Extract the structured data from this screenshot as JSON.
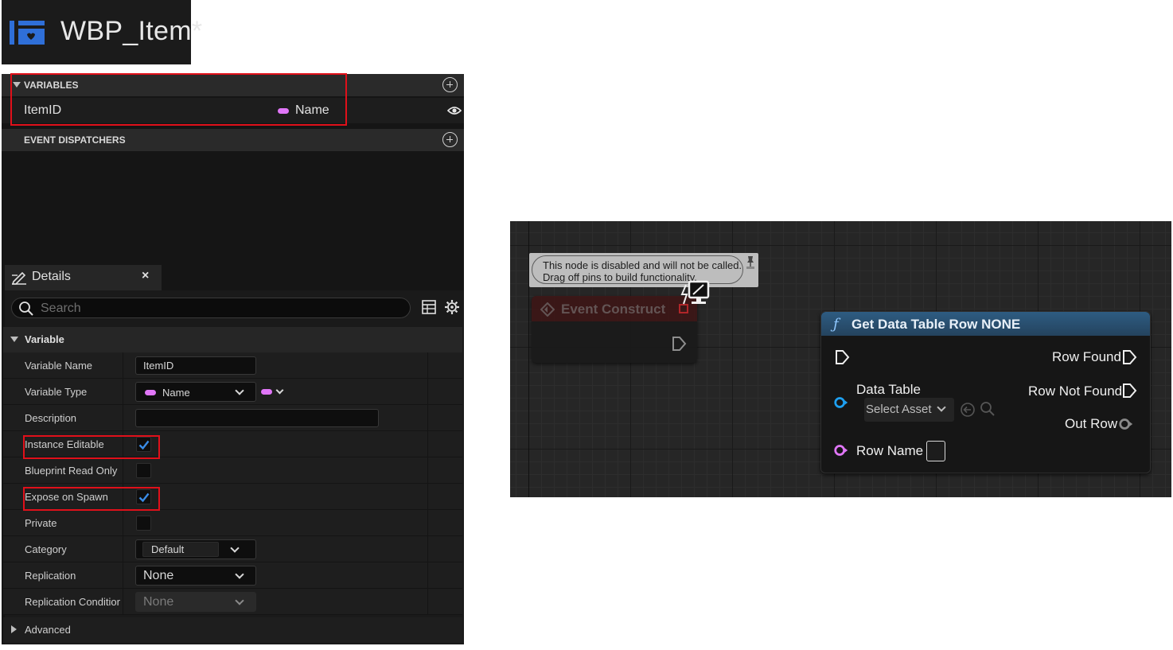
{
  "title_tab": {
    "title": "WBP_Item*",
    "icon": "widget-blueprint-icon"
  },
  "my_blueprint": {
    "variables_header": "VARIABLES",
    "variables": [
      {
        "name": "ItemID",
        "type": "Name",
        "type_color": "#e076f7"
      }
    ],
    "dispatchers_header": "EVENT DISPATCHERS"
  },
  "details": {
    "tab_label": "Details",
    "close_glyph": "×",
    "search_placeholder": "Search",
    "category": "Variable",
    "rows": {
      "variable_name": {
        "label": "Variable Name",
        "value": "ItemID"
      },
      "variable_type": {
        "label": "Variable Type",
        "value": "Name"
      },
      "description": {
        "label": "Description",
        "value": ""
      },
      "instance_editable": {
        "label": "Instance Editable",
        "checked": true
      },
      "blueprint_read_only": {
        "label": "Blueprint Read Only",
        "checked": false
      },
      "expose_on_spawn": {
        "label": "Expose on Spawn",
        "checked": true
      },
      "private": {
        "label": "Private",
        "checked": false
      },
      "category": {
        "label": "Category",
        "value": "Default"
      },
      "replication": {
        "label": "Replication",
        "value": "None"
      },
      "replication_condition": {
        "label": "Replication Condition",
        "value": "None"
      }
    },
    "advanced": "Advanced"
  },
  "graph": {
    "comment": {
      "line1": "This node is disabled and will not be called.",
      "line2": "Drag off pins to build functionality."
    },
    "event_node": {
      "title": "Event Construct",
      "header_color": "#3d1616"
    },
    "get_data_table_node": {
      "title": "Get Data Table Row NONE",
      "header_color": "#2e5c82",
      "outputs": {
        "row_found": "Row Found",
        "row_not_found": "Row Not Found",
        "out_row": "Out Row"
      },
      "inputs": {
        "data_table": "Data Table",
        "data_table_value": "Select Asset",
        "row_name": "Row Name"
      }
    }
  },
  "colors": {
    "highlight": "#e0101a",
    "checkbox_check": "#3a8ce8",
    "name_pin": "#e076f7",
    "object_pin": "#1ea0f0"
  }
}
